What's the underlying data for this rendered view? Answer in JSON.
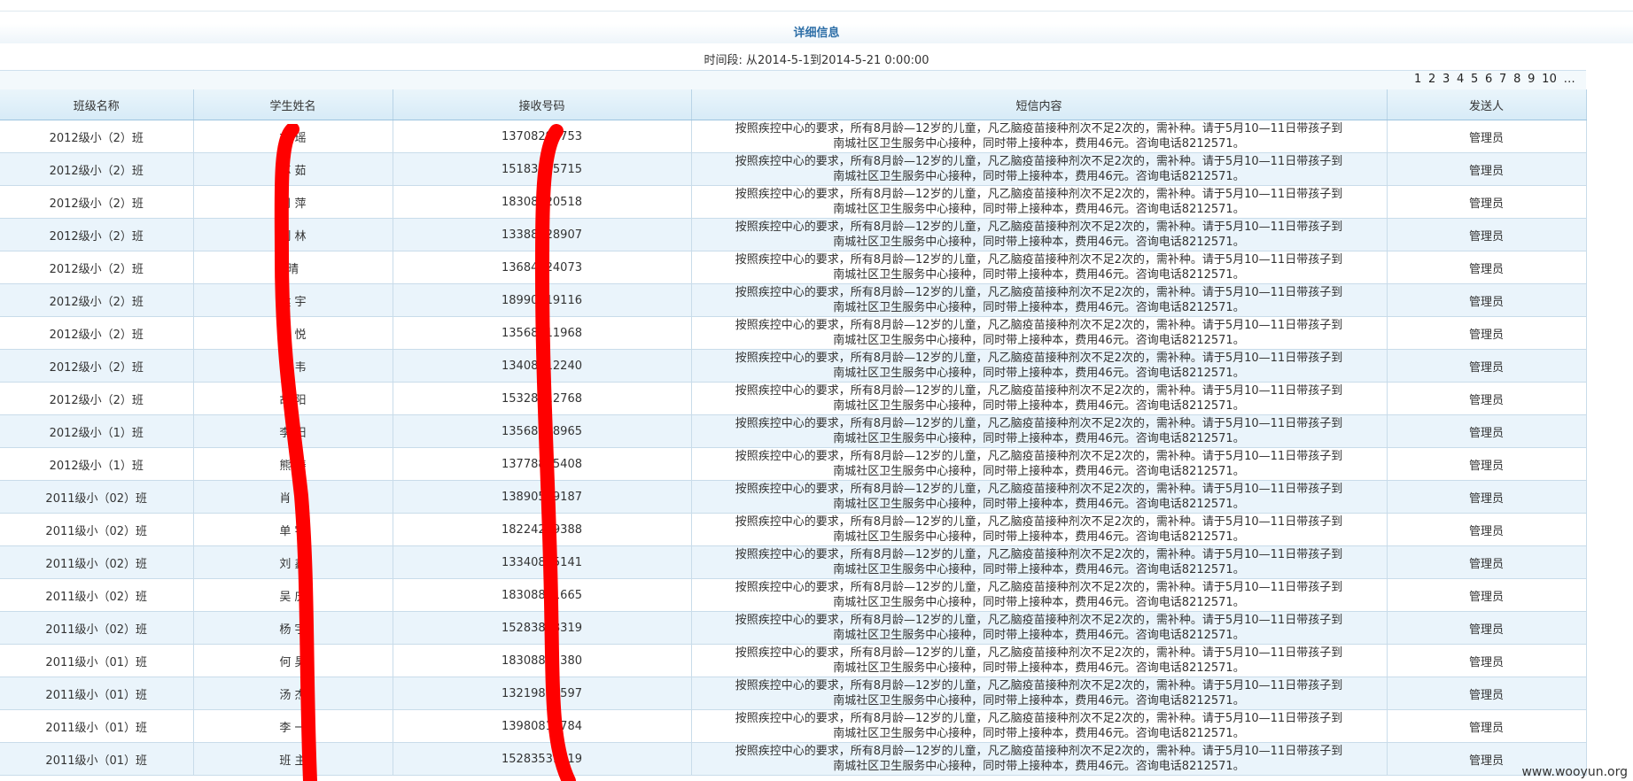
{
  "page": {
    "title": "详细信息",
    "period": "时间段: 从2014-5-1到2014-5-21 0:00:00"
  },
  "pager": [
    "1",
    "2",
    "3",
    "4",
    "5",
    "6",
    "7",
    "8",
    "9",
    "10",
    "..."
  ],
  "table": {
    "headers": [
      "班级名称",
      "学生姓名",
      "接收号码",
      "短信内容",
      "发送人"
    ],
    "message_line1": "按照疾控中心的要求，所有8月龄—12岁的儿童，凡乙脑疫苗接种剂次不足2次的，需补种。请于5月10—11日带孩子到",
    "message_line2": "南城社区卫生服务中心接种，同时带上接种本，费用46元。咨询电话8212571。",
    "rows": [
      {
        "class": "2012级小（2）班",
        "name": "刘 瑶",
        "number": "13708293753",
        "sender": "管理员"
      },
      {
        "class": "2012级小（2）班",
        "name": "苏 茹",
        "number": "15183165715",
        "sender": "管理员"
      },
      {
        "class": "2012级小（2）班",
        "name": "周 萍",
        "number": "18308120518",
        "sender": "管理员"
      },
      {
        "class": "2012级小（2）班",
        "name": "刘 林",
        "number": "13388828907",
        "sender": "管理员"
      },
      {
        "class": "2012级小（2）班",
        "name": "晴",
        "number": "13684124073",
        "sender": "管理员"
      },
      {
        "class": "2012级小（2）班",
        "name": "侯 宇",
        "number": "18990419116",
        "sender": "管理员"
      },
      {
        "class": "2012级小（2）班",
        "name": "唐 悦",
        "number": "13568811968",
        "sender": "管理员"
      },
      {
        "class": "2012级小（2）班",
        "name": "黄 韦",
        "number": "13408812240",
        "sender": "管理员"
      },
      {
        "class": "2012级小（2）班",
        "name": "胡 阳",
        "number": "15328812768",
        "sender": "管理员"
      },
      {
        "class": "2012级小（1）班",
        "name": "李 阳",
        "number": "13568828965",
        "sender": "管理员"
      },
      {
        "class": "2012级小（1）班",
        "name": "熊 涛",
        "number": "13778835408",
        "sender": "管理员"
      },
      {
        "class": "2011级小（02）班",
        "name": "肖 凯",
        "number": "13890519187",
        "sender": "管理员"
      },
      {
        "class": "2011级小（02）班",
        "name": "单 宇",
        "number": "18224219388",
        "sender": "管理员"
      },
      {
        "class": "2011级小（02）班",
        "name": "刘 鑫",
        "number": "13340825141",
        "sender": "管理员"
      },
      {
        "class": "2011级小（02）班",
        "name": "吴 庆",
        "number": "18308811665",
        "sender": "管理员"
      },
      {
        "class": "2011级小（02）班",
        "name": "杨 宇",
        "number": "15283818319",
        "sender": "管理员"
      },
      {
        "class": "2011级小（01）班",
        "name": "何 昊",
        "number": "18308835380",
        "sender": "管理员"
      },
      {
        "class": "2011级小（01）班",
        "name": "汤 杰",
        "number": "13219827597",
        "sender": "管理员"
      },
      {
        "class": "2011级小（01）班",
        "name": "李 一",
        "number": "13980815784",
        "sender": "管理员"
      },
      {
        "class": "2011级小（01）班",
        "name": "班 主",
        "number": "15283539519",
        "sender": "管理员"
      }
    ]
  },
  "watermark": "www.wooyun.org",
  "colors": {
    "title": "#2e6fa7",
    "row_alt": "#eaf4fb",
    "redaction": "#ff0000"
  }
}
